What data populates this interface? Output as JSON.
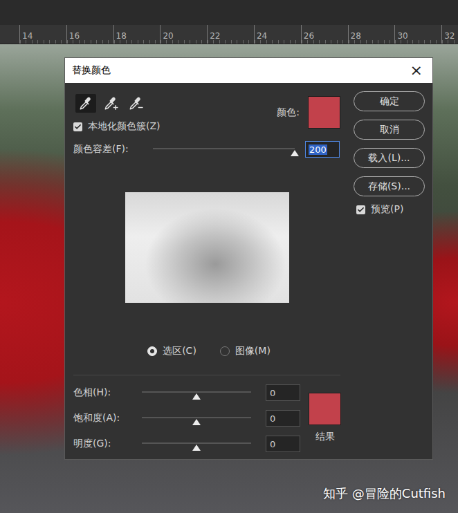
{
  "ruler": {
    "ticks": [
      "14",
      "16",
      "18",
      "20",
      "22",
      "24",
      "26",
      "28",
      "30",
      "32"
    ]
  },
  "dialog": {
    "title": "替换颜色",
    "close": "×",
    "tools": [
      {
        "kind": "sample",
        "selected": true
      },
      {
        "kind": "add",
        "selected": false
      },
      {
        "kind": "subtract",
        "selected": false
      }
    ],
    "localized_clusters": {
      "label": "本地化颜色簇(Z)",
      "checked": true
    },
    "color": {
      "label": "颜色:",
      "color": "#c2414b"
    },
    "fuzziness": {
      "label": "颜色容差(F):",
      "value": "200",
      "level": 1,
      "selected": true
    },
    "view_options": [
      {
        "label": "选区(C)",
        "selected": true
      },
      {
        "label": "图像(M)",
        "selected": false
      }
    ],
    "adjustments": [
      {
        "label": "色相(H):",
        "value": "0",
        "level": 0.5
      },
      {
        "label": "饱和度(A):",
        "value": "0",
        "level": 0.5
      },
      {
        "label": "明度(G):",
        "value": "0",
        "level": 0.5
      }
    ],
    "result": {
      "label": "结果",
      "color": "#c2414b"
    },
    "buttons": [
      "确定",
      "取消",
      "载入(L)...",
      "存储(S)..."
    ],
    "preview": {
      "label": "预览(P)",
      "checked": true
    }
  },
  "watermark": "知乎 @冒险的Cutfish"
}
